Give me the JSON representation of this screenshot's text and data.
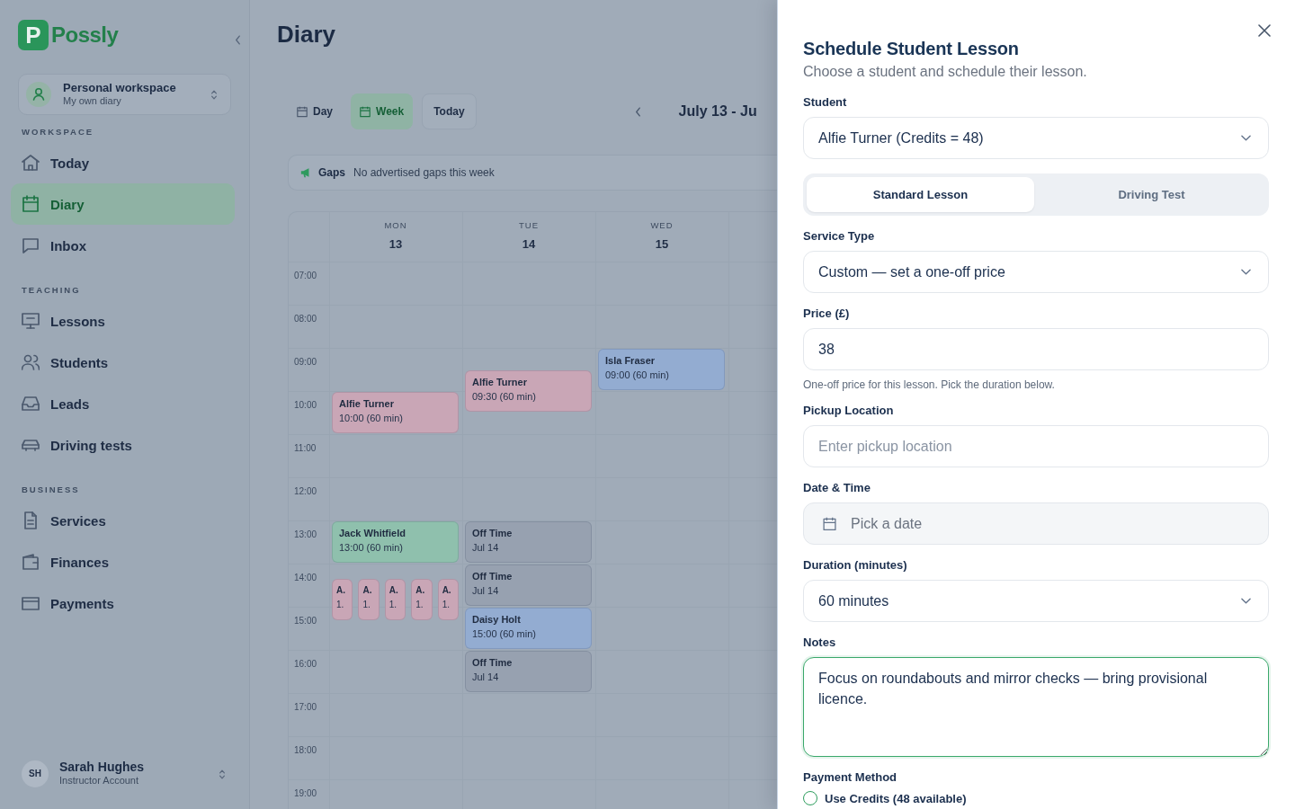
{
  "sidebar": {
    "logo": {
      "mark": "P",
      "name": "Possly"
    },
    "workspace": {
      "name": "Personal workspace",
      "subtitle": "My own diary"
    },
    "sections": [
      {
        "title": "WORKSPACE",
        "items": [
          {
            "label": "Today",
            "selected": false
          },
          {
            "label": "Diary",
            "selected": true
          },
          {
            "label": "Inbox",
            "selected": false
          }
        ]
      },
      {
        "title": "TEACHING",
        "items": [
          {
            "label": "Lessons",
            "selected": false
          },
          {
            "label": "Students",
            "selected": false
          },
          {
            "label": "Leads",
            "selected": false
          },
          {
            "label": "Driving tests",
            "selected": false
          }
        ]
      },
      {
        "title": "BUSINESS",
        "items": [
          {
            "label": "Services",
            "selected": false
          },
          {
            "label": "Finances",
            "selected": false
          },
          {
            "label": "Payments",
            "selected": false
          }
        ]
      }
    ],
    "user": {
      "initials": "SH",
      "name": "Sarah Hughes",
      "role": "Instructor Account"
    }
  },
  "main": {
    "title": "Diary",
    "view_tabs": [
      {
        "label": "Day",
        "selected": false
      },
      {
        "label": "Week",
        "selected": true
      }
    ],
    "today_button": "Today",
    "range": "July 13 - Ju",
    "gaps": {
      "title": "Gaps",
      "text": "No advertised gaps this week"
    },
    "calendar": {
      "days": [
        {
          "weekday": "MON",
          "date": "13"
        },
        {
          "weekday": "TUE",
          "date": "14"
        },
        {
          "weekday": "WED",
          "date": "15"
        }
      ],
      "rows": [
        {
          "time": "07:00"
        },
        {
          "time": "08:00"
        },
        {
          "time": "09:00",
          "tue": [
            {
              "kind": "event",
              "title": "Alfie Turner",
              "detail": "09:30 (60 min)",
              "color": "#c9a6b6"
            }
          ],
          "wed": [
            {
              "kind": "event",
              "title": "Isla Fraser",
              "detail": "09:00 (60 min)",
              "color": "#93acd1"
            }
          ]
        },
        {
          "time": "10:00",
          "mon": [
            {
              "kind": "event",
              "title": "Alfie Turner",
              "detail": "10:00 (60 min)",
              "color": "#c9a6b6"
            }
          ]
        },
        {
          "time": "11:00"
        },
        {
          "time": "12:00"
        },
        {
          "time": "13:00",
          "mon": [
            {
              "kind": "event",
              "title": "Jack Whitfield",
              "detail": "13:00 (60 min)",
              "color": "#8fc0ad"
            }
          ],
          "tue": [
            {
              "kind": "event",
              "title": "Off Time",
              "detail": "Jul 14",
              "color": "#97a1b0"
            }
          ]
        },
        {
          "time": "14:00",
          "mon": [
            {
              "kind": "stack",
              "items": [
                {
                  "title": "A.",
                  "detail": "1.",
                  "color": "#c9a6b6"
                },
                {
                  "title": "A.",
                  "detail": "1.",
                  "color": "#c9a6b6"
                },
                {
                  "title": "A.",
                  "detail": "1.",
                  "color": "#c9a6b6"
                },
                {
                  "title": "A.",
                  "detail": "1.",
                  "color": "#c9a6b6"
                },
                {
                  "title": "A.",
                  "detail": "1.",
                  "color": "#c9a6b6"
                }
              ]
            }
          ],
          "tue": [
            {
              "kind": "event",
              "title": "Off Time",
              "detail": "Jul 14",
              "color": "#97a1b0"
            }
          ]
        },
        {
          "time": "15:00",
          "tue": [
            {
              "kind": "event",
              "title": "Daisy Holt",
              "detail": "15:00 (60 min)",
              "color": "#93acd1"
            }
          ]
        },
        {
          "time": "16:00",
          "tue": [
            {
              "kind": "event",
              "title": "Off Time",
              "detail": "Jul 14",
              "color": "#97a1b0"
            }
          ]
        },
        {
          "time": "17:00"
        },
        {
          "time": "18:00"
        },
        {
          "time": "19:00"
        }
      ]
    }
  },
  "drawer": {
    "title": "Schedule Student Lesson",
    "subtitle": "Choose a student and schedule their lesson.",
    "fields": [
      {
        "kind": "select",
        "label": "Student",
        "value": "Alfie Turner (Credits = 48)"
      },
      {
        "kind": "segmented",
        "options": [
          {
            "label": "Standard Lesson",
            "selected": true
          },
          {
            "label": "Driving Test",
            "selected": false
          }
        ]
      },
      {
        "kind": "select",
        "label": "Service Type",
        "value": "Custom — set a one-off price"
      },
      {
        "kind": "input",
        "label": "Price (£)",
        "value": "38",
        "help": "One-off price for this lesson. Pick the duration below."
      },
      {
        "kind": "input",
        "label": "Pickup Location",
        "placeholder": "Enter pickup location"
      },
      {
        "kind": "date",
        "label": "Date & Time",
        "placeholder": "Pick a date"
      },
      {
        "kind": "select",
        "label": "Duration (minutes)",
        "value": "60 minutes"
      },
      {
        "kind": "textarea",
        "label": "Notes",
        "value": "Focus on roundabouts and mirror checks — bring provisional licence.",
        "focused": true
      },
      {
        "kind": "radio_group",
        "label": "Payment Method",
        "options": [
          {
            "label": "Use Credits (48 available)",
            "selected": false
          }
        ]
      }
    ]
  }
}
